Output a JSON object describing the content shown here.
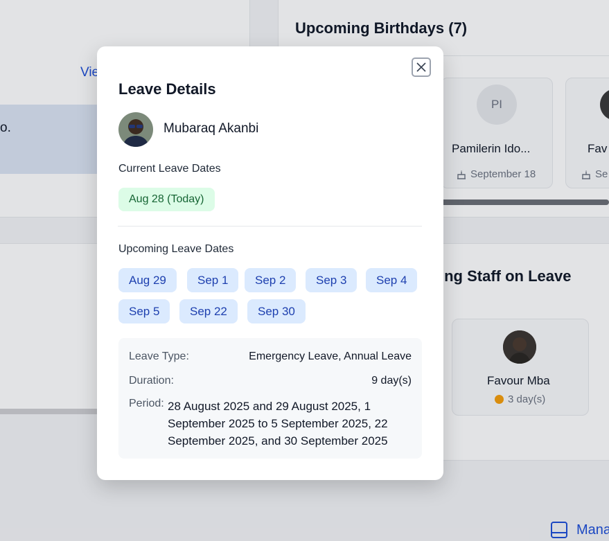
{
  "background": {
    "view_link": "Vie",
    "strip_text": "o.",
    "birthdays": {
      "title": "Upcoming Birthdays (7)",
      "cards": [
        {
          "initials": "PI",
          "name": "Pamilerin Ido...",
          "date": "September 18"
        },
        {
          "initials": "",
          "name": "Fav",
          "date": "Se"
        }
      ]
    },
    "staff_on_leave": {
      "title": "ing Staff on Leave",
      "card": {
        "name": "Favour Mba",
        "days": "3 day(s)"
      }
    },
    "manage_label": "Mana"
  },
  "modal": {
    "title": "Leave Details",
    "employee": {
      "name": "Mubaraq Akanbi"
    },
    "current_label": "Current Leave Dates",
    "current_date": "Aug 28 (Today)",
    "upcoming_label": "Upcoming Leave Dates",
    "upcoming_dates": [
      "Aug 29",
      "Sep 1",
      "Sep 2",
      "Sep 3",
      "Sep 4",
      "Sep 5",
      "Sep 22",
      "Sep 30"
    ],
    "details": {
      "leave_type_label": "Leave Type:",
      "leave_type_value": "Emergency Leave, Annual Leave",
      "duration_label": "Duration:",
      "duration_value": "9 day(s)",
      "period_label": "Period:",
      "period_value": "28 August 2025 and 29 August 2025, 1 September 2025 to 5 September 2025, 22 September 2025, and 30 September 2025"
    }
  },
  "icons": {
    "close": "close-icon",
    "cake": "cake-icon",
    "manage": "panel-icon"
  },
  "colors": {
    "today_bg": "#dcfce7",
    "today_text": "#166534",
    "chip_bg": "#dbeafe",
    "chip_text": "#1e40af",
    "link": "#1d4ed8"
  }
}
